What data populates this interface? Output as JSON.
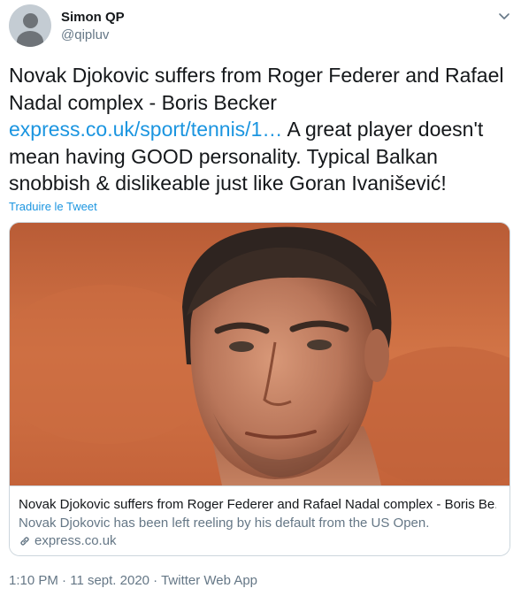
{
  "author": {
    "name": "Simon QP",
    "handle": "@qipluv"
  },
  "menu": {
    "caret_icon": "chevron-down-icon"
  },
  "tweet": {
    "text_part1": "Novak Djokovic suffers from Roger Federer and Rafael Nadal complex - Boris Becker ",
    "link_text": "express.co.uk/sport/tennis/1…",
    "text_part2": " A great player doesn't mean having GOOD personality. Typical Balkan snobbish & dislikeable just like Goran Ivanišević!",
    "translate_label": "Traduire le Tweet"
  },
  "card": {
    "title": "Novak Djokovic suffers from Roger Federer and Rafael Nadal complex - Boris Be...",
    "description": "Novak Djokovic has been left reeling by his default from the US Open.",
    "domain": "express.co.uk",
    "domain_icon": "link-icon"
  },
  "footer": {
    "time": "1:10 PM",
    "separator": " · ",
    "date": "11 sept. 2020",
    "source": "Twitter Web App"
  },
  "colors": {
    "link": "#1b95e0",
    "secondary_text": "#657786",
    "border": "#ccd6dd"
  }
}
